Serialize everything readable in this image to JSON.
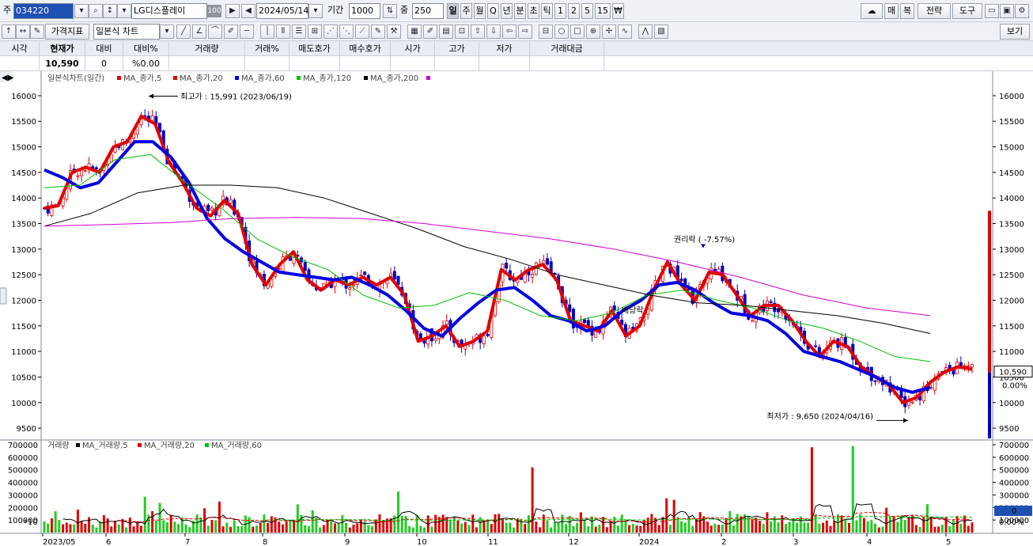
{
  "toolbar": {
    "stock_label": "주",
    "stock_code": "034220",
    "stock_name": "LG디스플레이",
    "badge": "100",
    "date": "2024/05/14",
    "period_label": "기간",
    "period_value": "1000",
    "count_label": "중",
    "count_value": "250",
    "intervals": [
      "일",
      "주",
      "월",
      "Q",
      "년",
      "분",
      "초",
      "틱",
      "1",
      "2",
      "5",
      "15",
      "₩"
    ],
    "active_interval": "일",
    "right_buttons": [
      "매",
      "복",
      "전략",
      "도구"
    ],
    "indicator_btn": "가격지표",
    "chart_type": "일본식 차트",
    "view_btn": "보기"
  },
  "quote": {
    "headers": [
      "시각",
      "현재가",
      "대비",
      "대비%",
      "거래량",
      "거래%",
      "매도호가",
      "매수호가",
      "시가",
      "고가",
      "저가",
      "거래대금"
    ],
    "values": [
      "",
      "10,590",
      "0",
      "%0.00",
      "",
      "",
      "",
      "",
      "",
      "",
      "",
      ""
    ]
  },
  "legend": {
    "price_title": "일본식차트(일간)",
    "price_items": [
      {
        "label": "MA_종가,5",
        "color": "#e00000"
      },
      {
        "label": "MA_종가,20",
        "color": "#e00000"
      },
      {
        "label": "MA_종가,60",
        "color": "#0000e0"
      },
      {
        "label": "MA_종가,120",
        "color": "#00c000"
      },
      {
        "label": "MA_종가,200",
        "color": "#000000"
      }
    ],
    "volume_title": "거래량",
    "volume_items": [
      {
        "label": "MA_거래량,5",
        "color": "#000000"
      },
      {
        "label": "MA_거래량,20",
        "color": "#e00000"
      },
      {
        "label": "MA_거래량,60",
        "color": "#00c000"
      }
    ],
    "volume_scale": "*10"
  },
  "annotations": {
    "high": "최고가 : 15,991 (2023/06/19)",
    "low": "최저가 : 9,650 (2024/04/16)",
    "rights": "권리락 ( -7.57%)",
    "dividend": "배당락"
  },
  "price_axis": {
    "ticks": [
      "16000",
      "15500",
      "15000",
      "14500",
      "14000",
      "13500",
      "13000",
      "12500",
      "12000",
      "11500",
      "11000",
      "10500",
      "10000",
      "9500"
    ],
    "current": "10,590",
    "change_pct": "0.00%"
  },
  "volume_axis": {
    "ticks": [
      "700000",
      "600000",
      "500000",
      "400000",
      "300000",
      "200000",
      "100000"
    ],
    "current": "0",
    "change_pct": "0.00%"
  },
  "x_axis": [
    "2023/05",
    "6",
    "7",
    "8",
    "9",
    "10",
    "11",
    "12",
    "2024",
    "2",
    "3",
    "4",
    "5"
  ],
  "colors": {
    "up": "#e00000",
    "down": "#0000c0",
    "ma5": "#e00000",
    "ma20": "#0000e0",
    "ma60": "#00c000",
    "ma120": "#000000",
    "ma200": "#d000d0"
  },
  "chart_data": {
    "type": "candlestick",
    "x_range": [
      "2023/05",
      "2024/05/14"
    ],
    "ylim": [
      9300,
      16200
    ],
    "volume_ylim": [
      0,
      700000
    ],
    "series": [
      {
        "name": "MA_종가,5",
        "values": [
          13800,
          13850,
          14500,
          14600,
          14500,
          15000,
          15100,
          15600,
          15450,
          14700,
          14300,
          13800,
          13650,
          13950,
          13700,
          12700,
          12300,
          12700,
          12950,
          12400,
          12200,
          12400,
          12300,
          12450,
          12300,
          12450,
          12100,
          11200,
          11300,
          11500,
          11100,
          11200,
          11400,
          12600,
          12400,
          12600,
          12700,
          12400,
          11600,
          11500,
          11400,
          11800,
          11300,
          11500,
          12200,
          12750,
          12300,
          12000,
          12550,
          12500,
          12100,
          11700,
          11900,
          11900,
          11600,
          11200,
          10900,
          11200,
          11100,
          10700,
          10500,
          10350,
          10000,
          10100,
          10400,
          10600,
          10700,
          10650
        ]
      },
      {
        "name": "MA_종가,20",
        "values": [
          14550,
          14400,
          14200,
          14300,
          14700,
          15100,
          15100,
          14800,
          14300,
          13600,
          13200,
          12950,
          12750,
          12550,
          12500,
          12450,
          12400,
          12450,
          12300,
          12100,
          11800,
          11450,
          11300,
          11650,
          11950,
          12200,
          12250,
          12000,
          11700,
          11600,
          11400,
          11500,
          11800,
          12000,
          12300,
          12350,
          12200,
          11950,
          11750,
          11700,
          11600,
          11350,
          11000,
          10900,
          10800,
          10650,
          10500,
          10300,
          10200,
          10300
        ]
      },
      {
        "name": "MA_종가,60",
        "values": [
          14200,
          14250,
          14750,
          14850,
          14300,
          13800,
          13200,
          12850,
          12600,
          12100,
          11850,
          11900,
          12150,
          12000,
          11700,
          11600,
          11750,
          12100,
          12200,
          12000,
          11850,
          11600,
          11450,
          11200,
          10900,
          10800
        ]
      },
      {
        "name": "MA_종가,120",
        "values": [
          13450,
          13700,
          14100,
          14250,
          14250,
          14200,
          14000,
          13700,
          13400,
          13050,
          12800,
          12500,
          12300,
          12100,
          11950,
          11900,
          11800,
          11700,
          11550,
          11350
        ]
      },
      {
        "name": "MA_종가,200",
        "values": [
          13450,
          13480,
          13520,
          13600,
          13620,
          13600,
          13500,
          13350,
          13200,
          13000,
          12750,
          12450,
          12100,
          11850,
          11700
        ]
      }
    ]
  }
}
